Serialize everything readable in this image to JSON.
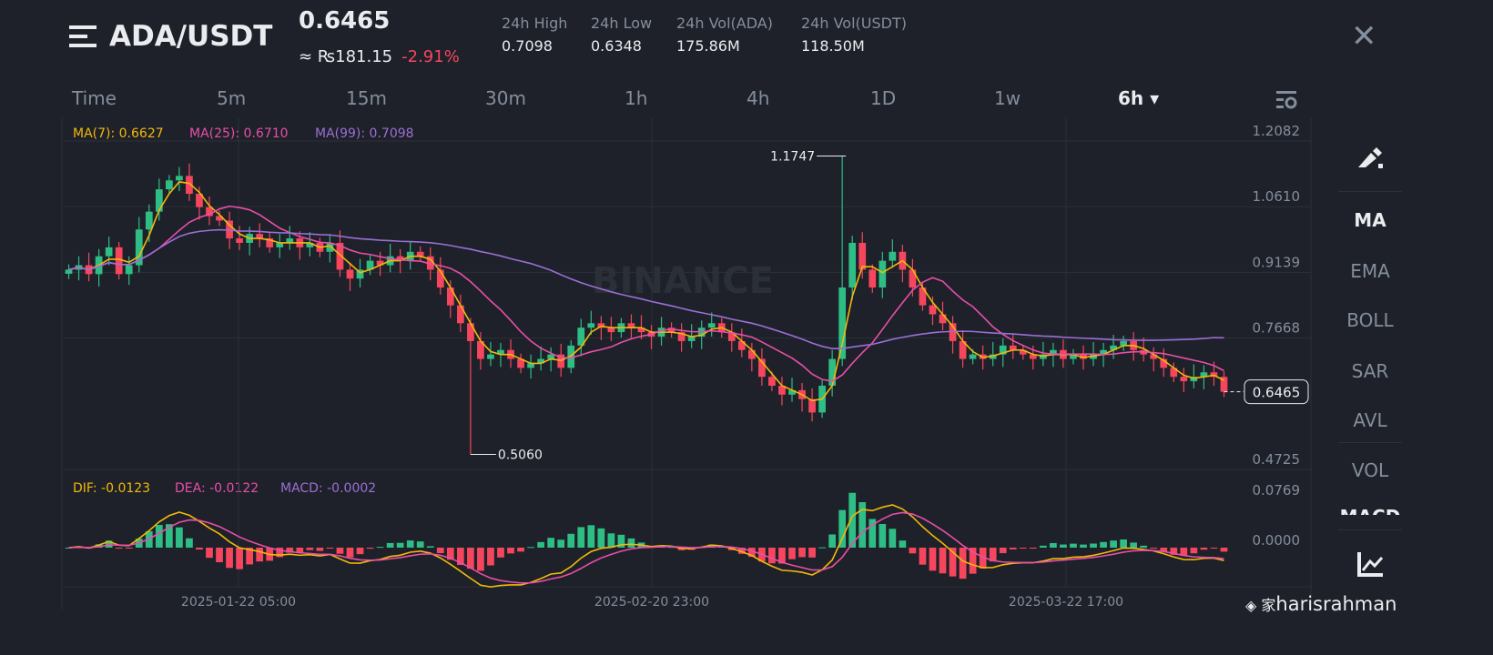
{
  "header": {
    "pair": "ADA/USDT",
    "price": "0.6465",
    "fiat": "≈ ₨181.15",
    "change": "-2.91%",
    "stats": [
      {
        "label": "24h High",
        "value": "0.7098"
      },
      {
        "label": "24h Low",
        "value": "0.6348"
      },
      {
        "label": "24h Vol(ADA)",
        "value": "175.86M"
      },
      {
        "label": "24h Vol(USDT)",
        "value": "118.50M"
      }
    ]
  },
  "tabs": [
    "Time",
    "5m",
    "15m",
    "30m",
    "1h",
    "4h",
    "1D",
    "1w",
    "6h ▾"
  ],
  "legend": {
    "ma7": "MA(7): 0.6627",
    "ma25": "MA(25): 0.6710",
    "ma99": "MA(99): 0.7098",
    "dif": "DIF: -0.0123",
    "dea": "DEA: -0.0122",
    "macd": "MACD: -0.0002"
  },
  "indicators": [
    "MA",
    "EMA",
    "BOLL",
    "SAR",
    "AVL",
    "VOL",
    "MACD"
  ],
  "watermark": "BINANCE",
  "credit": "harisrahman",
  "colors": {
    "up": "#2ebd85",
    "down": "#f6465d",
    "ma7": "#f0b90b",
    "ma25": "#e84fa9",
    "ma99": "#9b6fd6"
  },
  "chart_data": {
    "type": "candlestick",
    "price_axis": [
      "1.2082",
      "1.0610",
      "0.9139",
      "0.7668",
      "0.6465",
      "0.4725"
    ],
    "price_range": [
      0.4725,
      1.2082
    ],
    "macd_axis": [
      "0.0769",
      "0.0000"
    ],
    "time_labels": [
      "2025-01-22 05:00",
      "2025-02-20 23:00",
      "2025-03-22 17:00"
    ],
    "last_price": "0.6465",
    "max_label": "1.1747",
    "max_index": 77,
    "max_value": 1.1747,
    "min_label": "0.5060",
    "min_index": 40,
    "min_value": 0.506,
    "closes": [
      0.92,
      0.93,
      0.91,
      0.95,
      0.97,
      0.91,
      0.93,
      1.01,
      1.05,
      1.1,
      1.12,
      1.13,
      1.09,
      1.06,
      1.04,
      1.03,
      0.99,
      0.98,
      1.0,
      0.99,
      0.97,
      0.98,
      0.99,
      0.97,
      0.98,
      0.96,
      0.98,
      0.92,
      0.9,
      0.92,
      0.94,
      0.93,
      0.95,
      0.94,
      0.96,
      0.95,
      0.92,
      0.88,
      0.84,
      0.8,
      0.76,
      0.72,
      0.73,
      0.74,
      0.72,
      0.7,
      0.71,
      0.72,
      0.73,
      0.7,
      0.75,
      0.79,
      0.8,
      0.79,
      0.78,
      0.8,
      0.79,
      0.78,
      0.77,
      0.79,
      0.78,
      0.76,
      0.77,
      0.79,
      0.8,
      0.78,
      0.76,
      0.74,
      0.72,
      0.68,
      0.66,
      0.64,
      0.65,
      0.63,
      0.6,
      0.66,
      0.72,
      0.88,
      0.98,
      0.92,
      0.88,
      0.94,
      0.96,
      0.92,
      0.88,
      0.84,
      0.82,
      0.8,
      0.76,
      0.72,
      0.73,
      0.72,
      0.73,
      0.75,
      0.74,
      0.73,
      0.72,
      0.73,
      0.74,
      0.72,
      0.73,
      0.72,
      0.73,
      0.74,
      0.75,
      0.76,
      0.74,
      0.73,
      0.72,
      0.7,
      0.68,
      0.67,
      0.68,
      0.69,
      0.68,
      0.6465
    ]
  }
}
